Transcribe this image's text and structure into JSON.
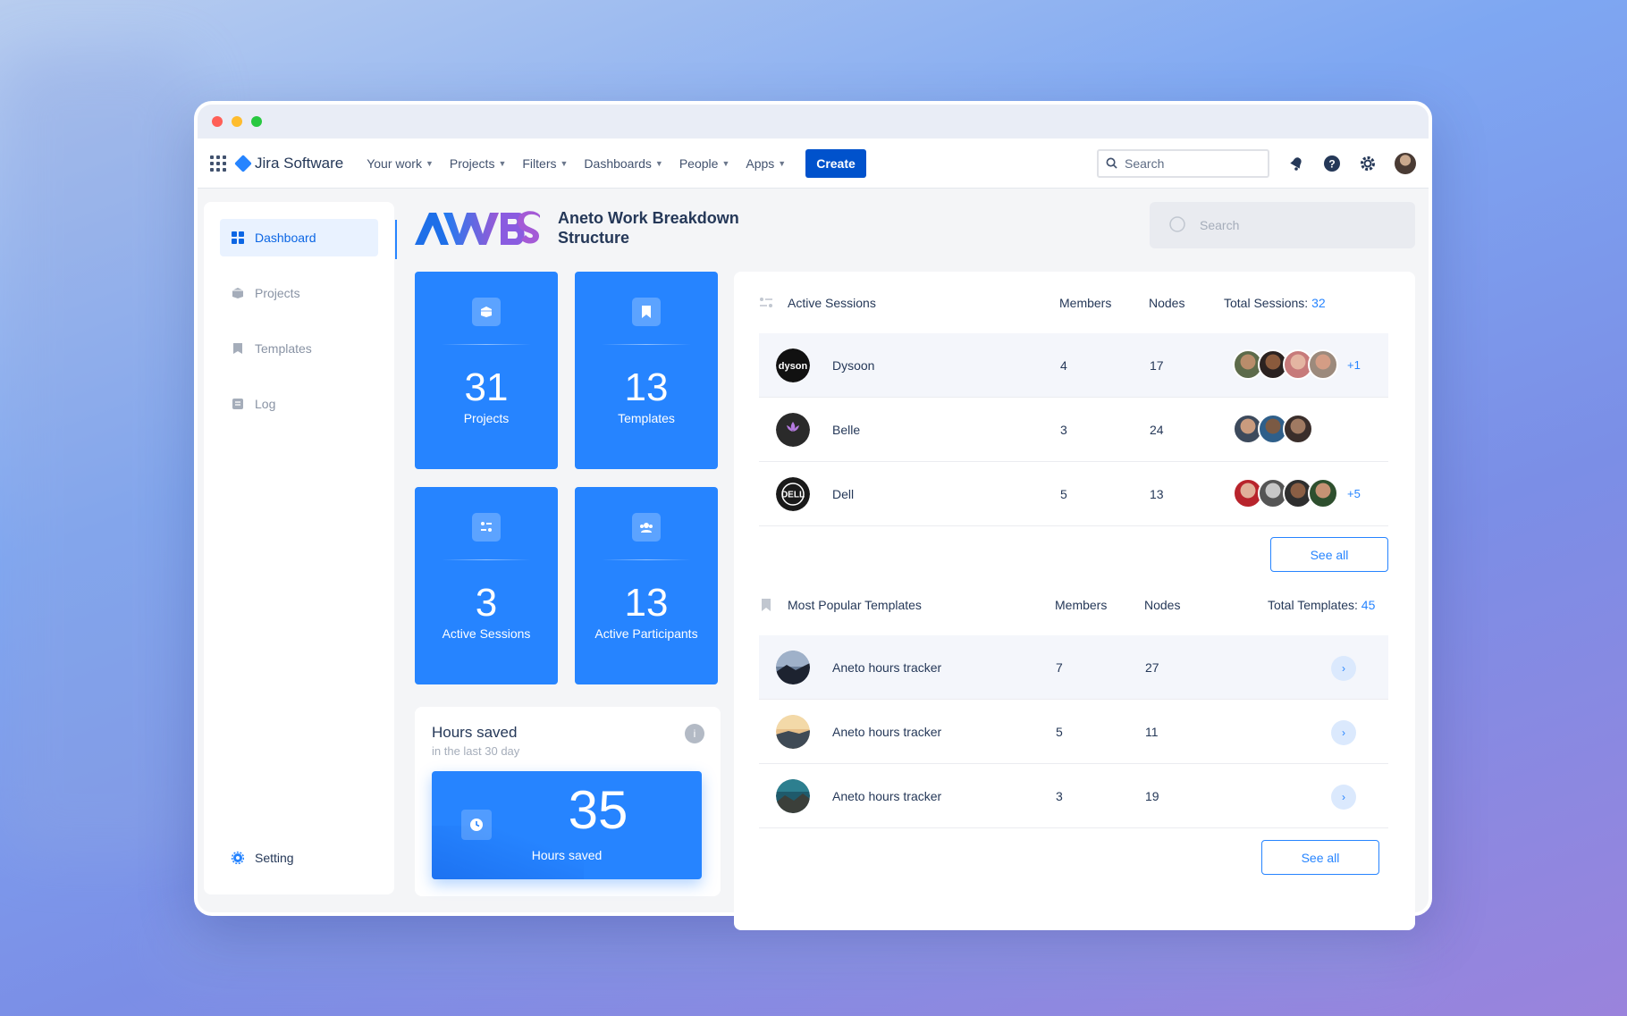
{
  "topnav": {
    "brand": "Jira Software",
    "items": [
      "Your work",
      "Projects",
      "Filters",
      "Dashboards",
      "People",
      "Apps"
    ],
    "create_label": "Create",
    "search_placeholder": "Search"
  },
  "sidebar": {
    "items": [
      {
        "label": "Dashboard",
        "icon": "dashboard-icon",
        "active": true
      },
      {
        "label": "Projects",
        "icon": "projects-icon",
        "active": false
      },
      {
        "label": "Templates",
        "icon": "bookmark-icon",
        "active": false
      },
      {
        "label": "Log",
        "icon": "log-icon",
        "active": false
      }
    ],
    "setting_label": "Setting"
  },
  "header": {
    "title": "Aneto Work Breakdown Structure",
    "search_placeholder": "Search"
  },
  "stats": [
    {
      "value": "31",
      "label": "Projects",
      "icon": "box-icon"
    },
    {
      "value": "13",
      "label": "Templates",
      "icon": "bookmark-icon"
    },
    {
      "value": "3",
      "label": "Active Sessions",
      "icon": "sessions-icon"
    },
    {
      "value": "13",
      "label": "Active Participants",
      "icon": "people-icon"
    }
  ],
  "hours": {
    "title": "Hours saved",
    "subtitle": "in the last 30 day",
    "info": "i",
    "value": "35",
    "label": "Hours saved"
  },
  "sessions": {
    "title": "Active Sessions",
    "col_members": "Members",
    "col_nodes": "Nodes",
    "total_label": "Total Sessions:",
    "total_value": "32",
    "rows": [
      {
        "name": "Dysoon",
        "members": "4",
        "nodes": "17",
        "more": "+1"
      },
      {
        "name": "Belle",
        "members": "3",
        "nodes": "24",
        "more": ""
      },
      {
        "name": "Dell",
        "members": "5",
        "nodes": "13",
        "more": "+5"
      }
    ],
    "see_all": "See all"
  },
  "templates": {
    "title": "Most Popular Templates",
    "col_members": "Members",
    "col_nodes": "Nodes",
    "total_label": "Total Templates:",
    "total_value": "45",
    "rows": [
      {
        "name": "Aneto hours tracker",
        "members": "7",
        "nodes": "27"
      },
      {
        "name": "Aneto hours tracker",
        "members": "5",
        "nodes": "11"
      },
      {
        "name": "Aneto hours tracker",
        "members": "3",
        "nodes": "19"
      }
    ],
    "see_all": "See all"
  },
  "colors": {
    "accent": "#2684ff",
    "jira_blue": "#0052cc"
  }
}
